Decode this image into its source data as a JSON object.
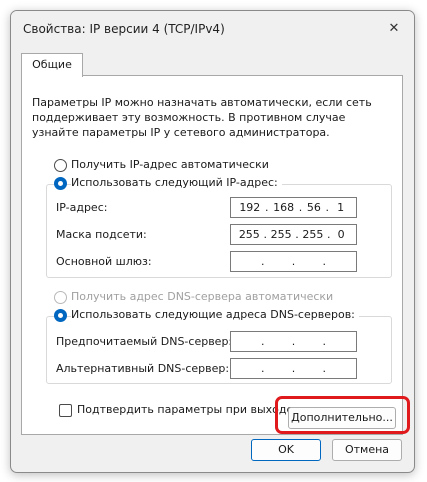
{
  "window": {
    "title": "Свойства: IP версии 4 (TCP/IPv4)",
    "close_glyph": "✕"
  },
  "tab": {
    "label": "Общие"
  },
  "description": "Параметры IP можно назначать автоматически, если сеть поддерживает эту возможность. В противном случае узнайте параметры IP у сетевого администратора.",
  "ip_section": {
    "auto_label": "Получить IP-адрес автоматически",
    "manual_label": "Использовать следующий IP-адрес:",
    "selected": "manual",
    "fields": [
      {
        "label": "IP-адрес:",
        "octets": [
          "192",
          "168",
          "56",
          "1"
        ]
      },
      {
        "label": "Маска подсети:",
        "octets": [
          "255",
          "255",
          "255",
          "0"
        ]
      },
      {
        "label": "Основной шлюз:",
        "octets": [
          "",
          "",
          "",
          ""
        ]
      }
    ]
  },
  "dns_section": {
    "auto_label": "Получить адрес DNS-сервера автоматически",
    "manual_label": "Использовать следующие адреса DNS-серверов:",
    "selected": "manual",
    "fields": [
      {
        "label": "Предпочитаемый DNS-сервер:",
        "octets": [
          "",
          "",
          "",
          ""
        ]
      },
      {
        "label": "Альтернативный DNS-сервер:",
        "octets": [
          "",
          "",
          "",
          ""
        ]
      }
    ]
  },
  "validate_checkbox": {
    "label": "Подтвердить параметры при выходе",
    "checked": false
  },
  "buttons": {
    "advanced": "Дополнительно...",
    "ok": "OK",
    "cancel": "Отмена"
  },
  "colors": {
    "accent": "#0067c0",
    "highlight": "#e0191c"
  }
}
